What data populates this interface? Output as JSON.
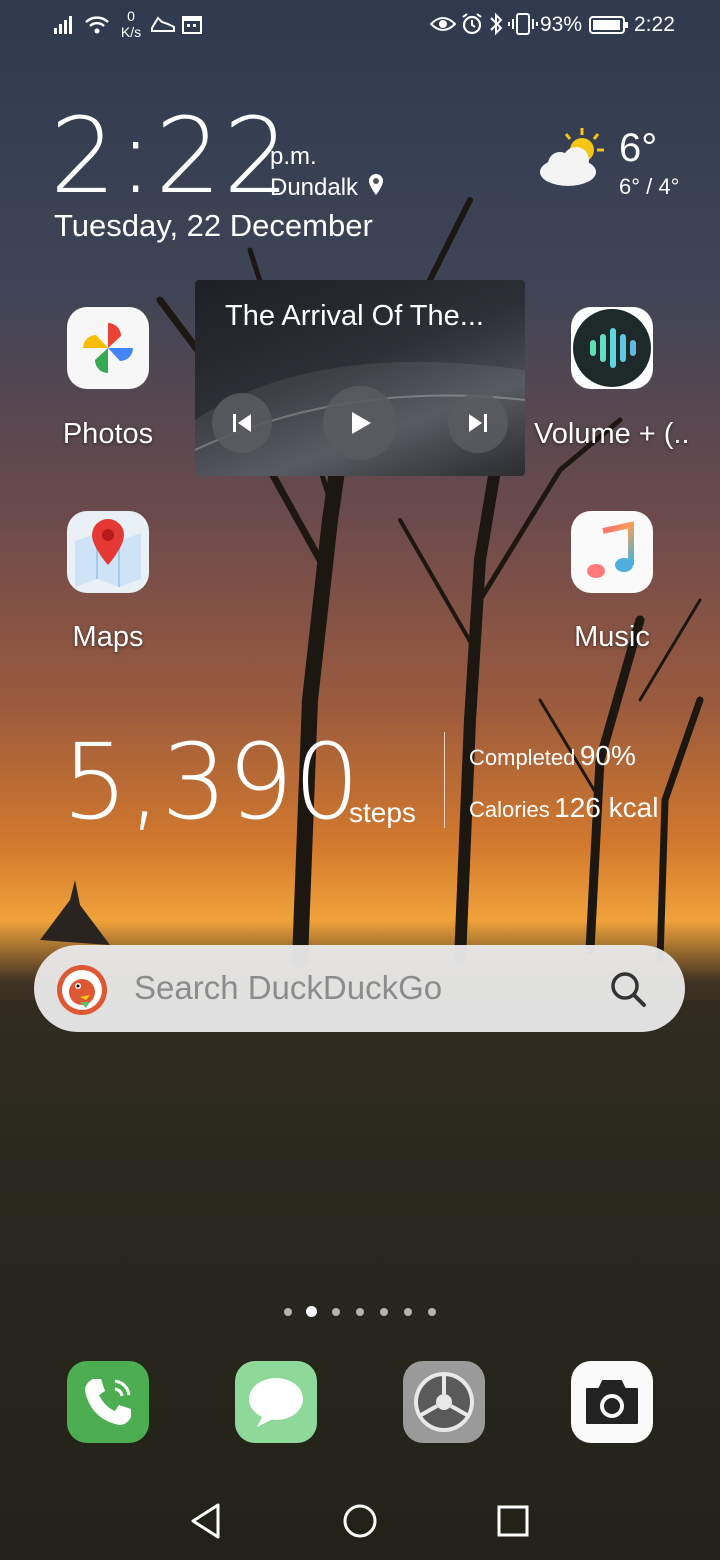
{
  "status_bar": {
    "net_speed_value": "0",
    "net_speed_unit": "K/s",
    "battery_percent": "93%",
    "time": "2:22"
  },
  "clock_widget": {
    "time": "2:22",
    "ampm": "p.m.",
    "city": "Dundalk",
    "date": "Tuesday, 22 December",
    "temperature": "6°",
    "temp_range": "6° / 4°"
  },
  "apps": {
    "photos": "Photos",
    "volume": "Volume + (..",
    "maps": "Maps",
    "music": "Music"
  },
  "music_widget": {
    "track_title": "The Arrival Of The..."
  },
  "steps_widget": {
    "steps": "5,390",
    "steps_label": "steps",
    "completed_label": "Completed",
    "completed_value": "90%",
    "calories_label": "Calories",
    "calories_value": "126 kcal"
  },
  "search": {
    "placeholder": "Search DuckDuckGo"
  },
  "page_indicator": {
    "count": 7,
    "active_index": 1
  },
  "colors": {
    "phone_green": "#4cae50",
    "messages_green": "#8ed89a",
    "settings_gray": "#9a9a9a",
    "search_bg": "#e8e8e8"
  }
}
